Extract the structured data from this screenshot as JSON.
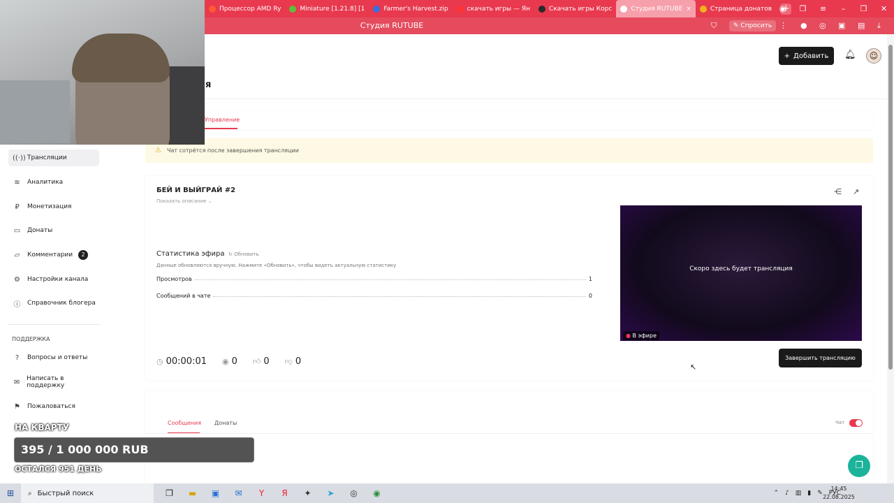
{
  "browser": {
    "tabs": [
      {
        "label": "Процессор AMD Ry",
        "color": "#ff5a36",
        "active": false
      },
      {
        "label": "Miniature [1.21.8] [1",
        "color": "#5fbf3b",
        "active": false
      },
      {
        "label": "Farmer's Harvest.zip",
        "color": "#3b6ed9",
        "active": false
      },
      {
        "label": "скачать игры — Ян",
        "color": "#ff3333",
        "active": false
      },
      {
        "label": "Скачать игры Корс",
        "color": "#2a2a2a",
        "active": false
      },
      {
        "label": "Студия RUTUBE",
        "color": "#ffffff",
        "active": true
      },
      {
        "label": "Страница донатов",
        "color": "#f2b21a",
        "active": false
      }
    ],
    "tab_close": "×",
    "new_tab": "+",
    "page_title": "Студия RUTUBE",
    "ask_label": "Спросить"
  },
  "header": {
    "add_label": "Добавить",
    "title_visible": "я"
  },
  "tabs": {
    "manage": "Управление"
  },
  "warning": "Чат сотрётся после завершения трансляции",
  "sidebar": {
    "items": [
      {
        "label": "Трансляции",
        "icon": "broadcast-icon",
        "active": true
      },
      {
        "label": "Аналитика",
        "icon": "chart-icon"
      },
      {
        "label": "Монетизация",
        "icon": "ruble-icon"
      },
      {
        "label": "Донаты",
        "icon": "donate-icon"
      },
      {
        "label": "Комментарии",
        "icon": "comment-icon",
        "badge": "2"
      },
      {
        "label": "Настройки канала",
        "icon": "gear-icon"
      },
      {
        "label": "Справочник блогера",
        "icon": "info-icon"
      }
    ],
    "support_heading": "ПОДДЕРЖКА",
    "support_items": [
      {
        "label": "Вопросы и ответы",
        "icon": "question-icon"
      },
      {
        "label": "Написать в поддержку",
        "icon": "mail-icon"
      },
      {
        "label": "Пожаловаться",
        "icon": "flag-icon"
      }
    ]
  },
  "stream": {
    "title": "БЕЙ И ВЫЙГРАЙ #2",
    "show_description": "Показать описание",
    "stats_title": "Статистика эфира",
    "refresh_label": "Обновить",
    "stats_note": "Данные обновляются вручную. Нажмите «Обновить», чтобы видеть актуальную статистику",
    "stats": [
      {
        "label": "Просмотров",
        "value": "1"
      },
      {
        "label": "Сообщений в чате",
        "value": "0"
      }
    ],
    "metrics": {
      "duration": "00:00:01",
      "viewers": "0",
      "likes": "0",
      "dislikes": "0"
    },
    "player_text": "Скоро здесь будет трансляция",
    "live_label": "В эфире",
    "end_button": "Завершить трансляцию"
  },
  "chat": {
    "tab_messages": "Сообщения",
    "tab_donates": "Донаты",
    "toggle_label": "Чат",
    "toggle_on": true
  },
  "overlay": {
    "goal": "НА КВАРТУ",
    "amount": "395 / 1 000 000 RUB",
    "remaining": "ОСТАЛСЯ 951 ДЕНЬ"
  },
  "taskbar": {
    "search_placeholder": "Быстрый поиск",
    "tray_lang": "РУС",
    "time": "14:45",
    "date": "22.08.2025"
  },
  "colors": {
    "accent": "#e8394f",
    "dark_button": "#1a1a1a",
    "help": "#1bb39a"
  }
}
